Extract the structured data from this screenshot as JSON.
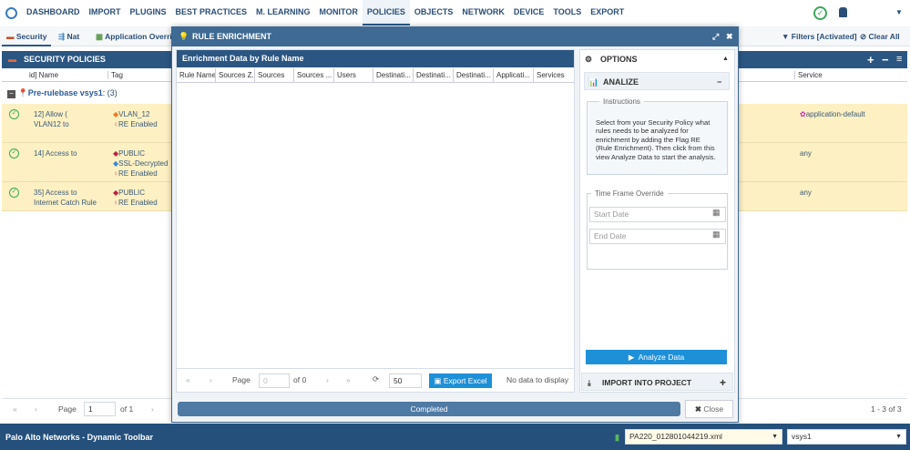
{
  "topnav": {
    "items": [
      "DASHBOARD",
      "IMPORT",
      "PLUGINS",
      "BEST PRACTICES",
      "M. LEARNING",
      "MONITOR",
      "POLICIES",
      "OBJECTS",
      "NETWORK",
      "DEVICE",
      "TOOLS",
      "EXPORT"
    ],
    "active": "POLICIES"
  },
  "subtabs": {
    "security": "Security",
    "nat": "Nat",
    "app_override": "Application Overrid",
    "filters": "Filters [Activated]",
    "clear_all": "Clear All"
  },
  "policies": {
    "title": "SECURITY POLICIES",
    "columns": {
      "name": "id] Name",
      "tag": "Tag",
      "service": "Service"
    },
    "group": {
      "label": "Pre-rulebase vsys1",
      "count": ": (3)"
    },
    "rows": [
      {
        "name": [
          "12] Allow (",
          "VLAN12 to"
        ],
        "tags": [
          "VLAN_12",
          "RE Enabled"
        ],
        "service": "application-default"
      },
      {
        "name": [
          "14] Access to"
        ],
        "tags": [
          "PUBLIC",
          "SSL-Decrypted",
          "RE Enabled"
        ],
        "service": "any"
      },
      {
        "name": [
          "35] Access to",
          "Internet Catch Rule"
        ],
        "tags": [
          "PUBLIC",
          "RE Enabled"
        ],
        "service": "any"
      }
    ],
    "pager": {
      "page_label": "Page",
      "page": "1",
      "of": "of 1",
      "summary": "1 - 3 of 3"
    }
  },
  "modal": {
    "title": "RULE ENRICHMENT",
    "grid": {
      "title": "Enrichment Data by Rule Name",
      "columns": [
        "Rule Name",
        "Sources Z...",
        "Sources",
        "Sources ...",
        "Users",
        "Destinati...",
        "Destinati...",
        "Destinati...",
        "Applicati...",
        "Services"
      ],
      "pager": {
        "page_label": "Page",
        "page": "0",
        "of": "of 0",
        "page_size": "50",
        "export": "Export Excel",
        "empty": "No data to display"
      }
    },
    "options": {
      "title": "OPTIONS",
      "analize": "ANALIZE",
      "instructions_title": "Instructions",
      "instructions": "Select from your Security Policy what rules needs to be analyzed for enrichment by adding the Flag RE (Rule Enrichment). Then click from this view Analyze Data to start the analysis.",
      "timeframe_title": "Time Frame Override",
      "start_placeholder": "Start Date",
      "end_placeholder": "End Date",
      "analyze_button": "Analyze Data",
      "import": "IMPORT INTO PROJECT"
    },
    "progress": {
      "label": "Completed",
      "percent": 100
    },
    "close": "Close"
  },
  "bottombar": {
    "title": "Palo Alto Networks - Dynamic Toolbar",
    "file": "PA220_012801044219.xml",
    "vsys": "vsys1"
  }
}
